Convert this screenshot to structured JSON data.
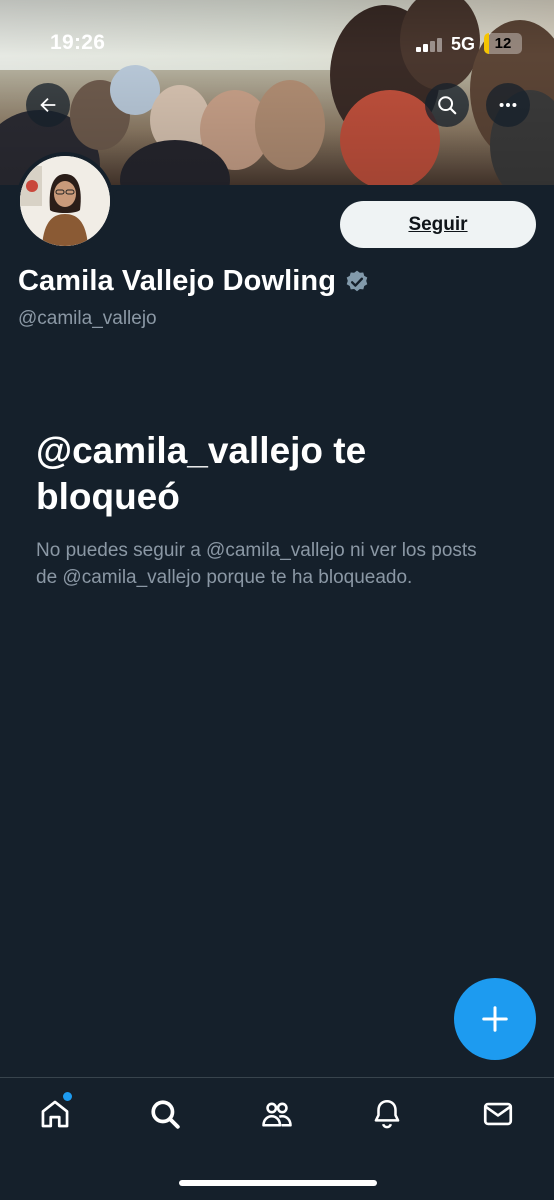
{
  "status_bar": {
    "time": "19:26",
    "network": "5G",
    "battery": "12",
    "battery_level": 0.12
  },
  "profile": {
    "name": "Camila Vallejo Dowling",
    "handle": "@camila_vallejo",
    "verified": true,
    "follow_label": "Seguir"
  },
  "blocked": {
    "title": "@camila_vallejo te bloqueó",
    "description": "No puedes seguir a @camila_vallejo ni ver los posts de @camila_vallejo porque te ha bloqueado."
  },
  "header_actions": {
    "back_icon": "arrow-left-icon",
    "search_icon": "search-icon",
    "more_icon": "more-horizontal-icon"
  },
  "fab": {
    "icon": "plus-icon"
  },
  "bottom_nav": {
    "items": [
      {
        "icon": "home-icon",
        "has_notification_dot": true
      },
      {
        "icon": "search-icon"
      },
      {
        "icon": "communities-icon"
      },
      {
        "icon": "bell-icon"
      },
      {
        "icon": "mail-icon"
      }
    ]
  },
  "colors": {
    "background": "#15202b",
    "accent": "#1d9bf0",
    "secondary_text": "#8b98a5",
    "battery": "#f5c400"
  }
}
